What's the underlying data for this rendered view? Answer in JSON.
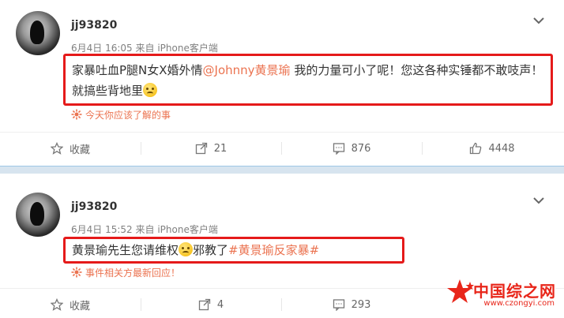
{
  "posts": [
    {
      "username": "jj93820",
      "date": "6月4日 16:05",
      "source_prefix": "来自",
      "source": "iPhone客户端",
      "content_pre": "家暴吐血P腿N女X婚外情",
      "mention": "@Johnny黄景瑜",
      "content_post": " 我的力量可小了呢！您这各种实锤都不敢吱声！就搞些背地里",
      "emoji": "smile-emoji",
      "topic_line": "今天你应该了解的事",
      "actions": {
        "favorite": "收藏",
        "repost_count": "21",
        "comment_count": "876",
        "like_count": "4448"
      }
    },
    {
      "username": "jj93820",
      "date": "6月4日 15:52",
      "source_prefix": "来自",
      "source": "iPhone客户端",
      "content_pre": "黄景瑜先生您请维权",
      "content_mid": "邪教了",
      "hashtag": "#黄景瑜反家暴#",
      "emoji": "smirk-emoji",
      "topic_line": "事件相关方最新回应！",
      "actions": {
        "favorite": "收藏",
        "repost_count": "4",
        "comment_count": "293"
      }
    }
  ],
  "watermark": {
    "title": "中国综之网",
    "url": "www.czongyi.com"
  },
  "colors": {
    "highlight_border": "#e51a1a",
    "accent": "#eb7350",
    "band": "#d7e4ef"
  },
  "icons": [
    "star-icon",
    "repost-icon",
    "comment-icon",
    "like-icon",
    "chevron-down-icon",
    "topic-icon"
  ]
}
